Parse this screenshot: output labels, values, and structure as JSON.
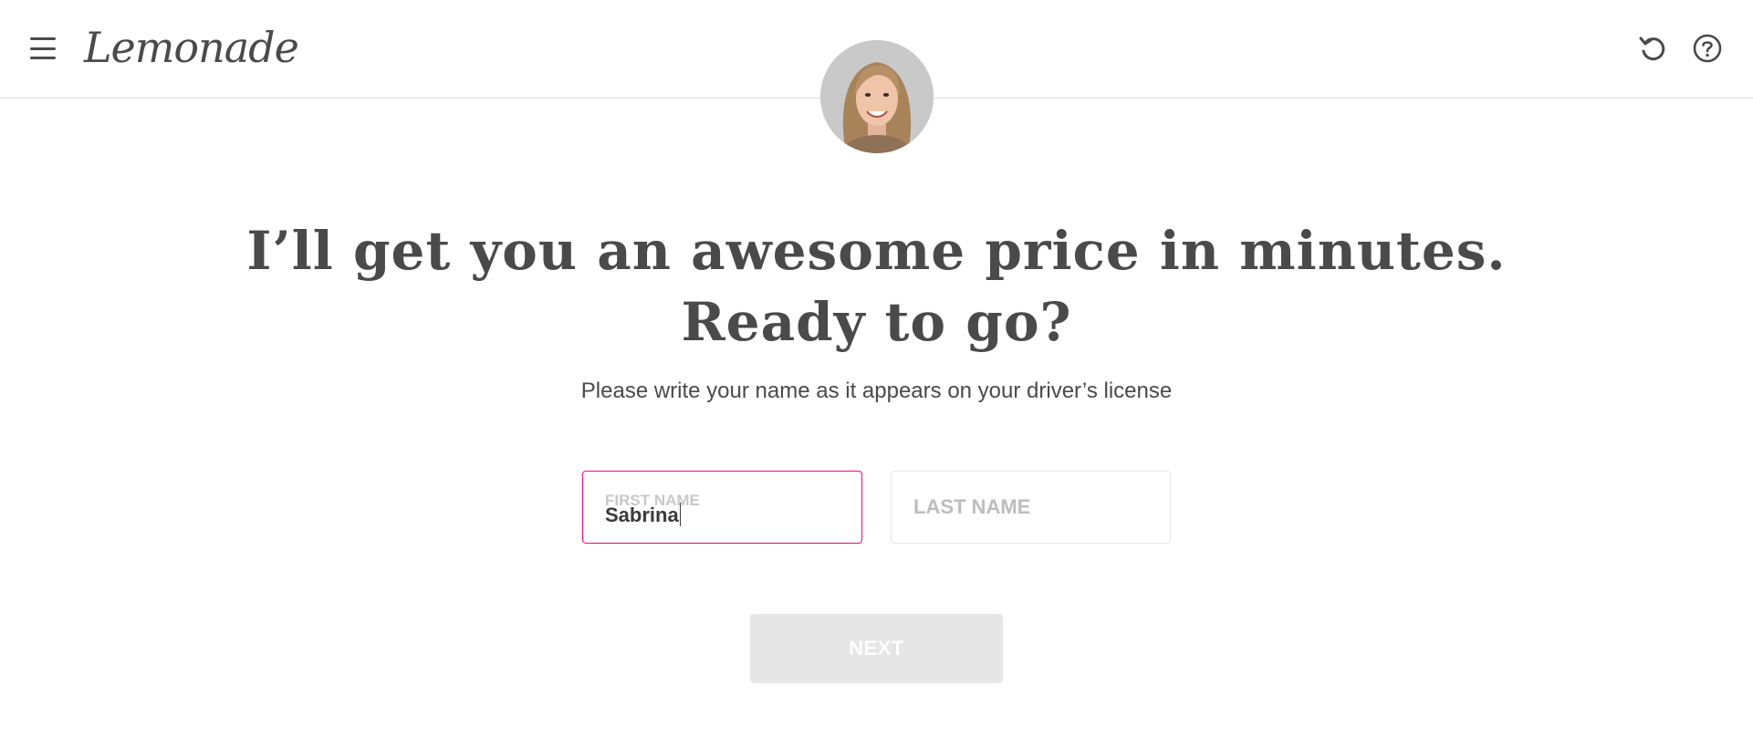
{
  "header": {
    "logo_text": "Lemonade",
    "menu_icon": "hamburger-menu-icon",
    "undo_icon": "undo-icon",
    "help_icon": "help-icon"
  },
  "avatar": {
    "icon": "avatar"
  },
  "main": {
    "headline_line1": "I’ll get you an awesome price in minutes.",
    "headline_line2": "Ready to go?",
    "subtitle": "Please write your name as it appears on your driver’s license"
  },
  "form": {
    "first_name": {
      "label": "FIRST NAME",
      "value": "Sabrina"
    },
    "last_name": {
      "placeholder": "LAST NAME",
      "value": ""
    },
    "next_label": "NEXT"
  },
  "colors": {
    "accent_pink": "#ff0083",
    "text": "#4a4a4a",
    "disabled_button": "#e6e6e6"
  }
}
